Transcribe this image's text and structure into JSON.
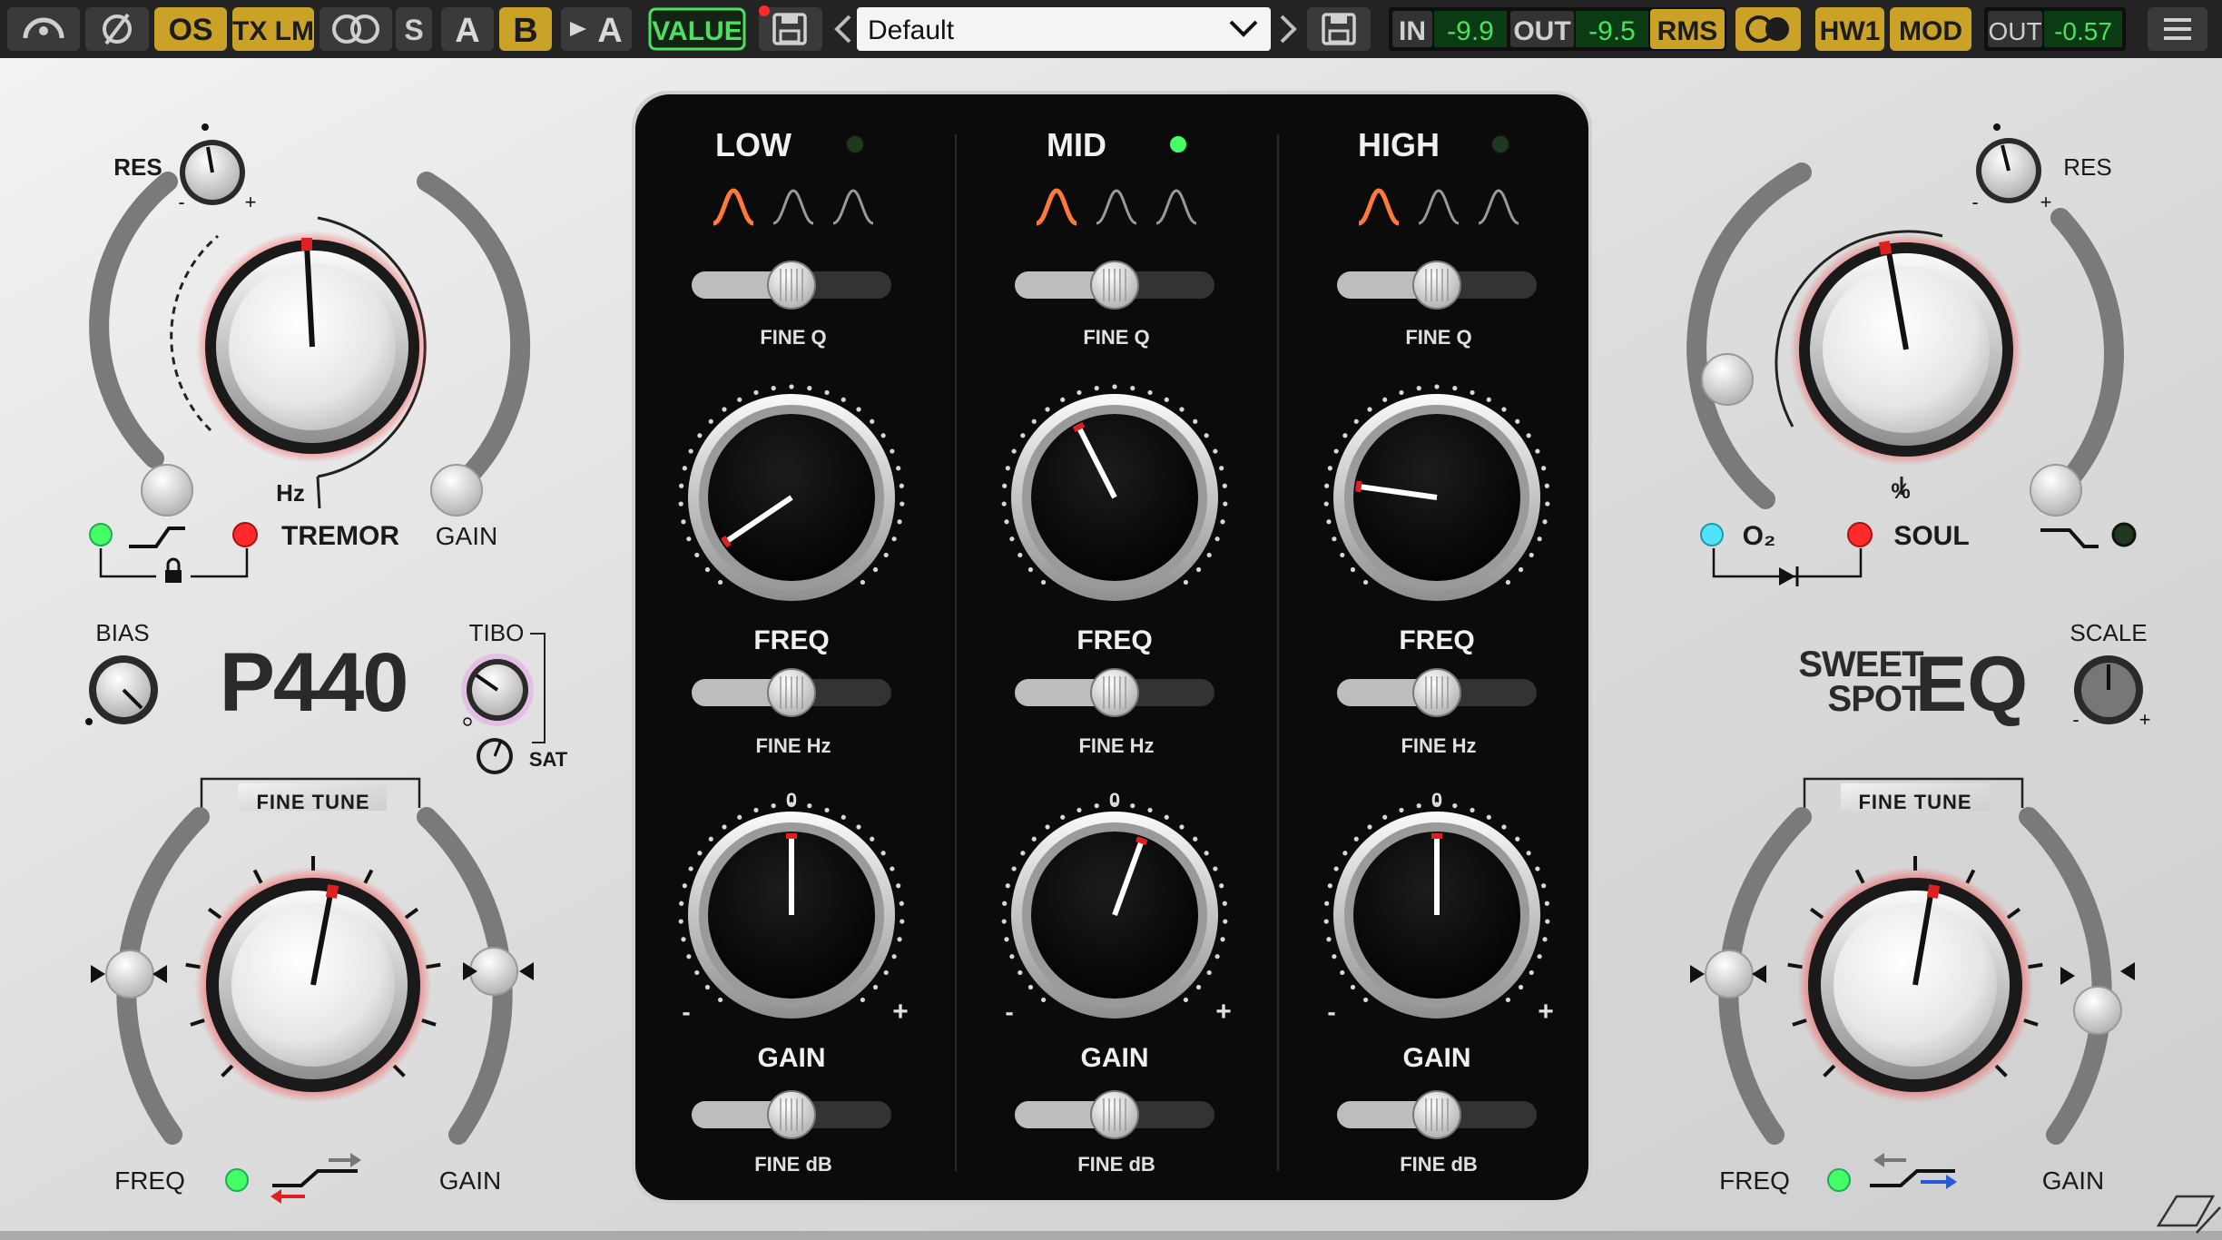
{
  "toolbar": {
    "os": "OS",
    "tx_lm": "TX LM",
    "s": "S",
    "a": "A",
    "b": "B",
    "copy_to_a": "A",
    "value": "VALUE",
    "preset": "Default",
    "in_label": "IN",
    "in_value": "-9.9",
    "out_label": "OUT",
    "out_value": "-9.5",
    "rms": "RMS",
    "hw1": "HW1",
    "mod": "MOD",
    "out2_label": "OUT",
    "out2_value": "-0.57"
  },
  "left": {
    "res": "RES",
    "tremor": "TREMOR",
    "gain_top": "GAIN",
    "hz": "Hz",
    "bias": "BIAS",
    "model": "P440",
    "tibo": "TIBO",
    "sat": "SAT",
    "fine_tune": "FINE TUNE",
    "freq": "FREQ",
    "gain_bottom": "GAIN",
    "minus": "-",
    "plus": "+"
  },
  "right": {
    "res": "RES",
    "o2": "O₂",
    "soul": "SOUL",
    "percent": "%",
    "logo_line1": "SWEET",
    "logo_line2": "SPOT",
    "logo_eq": "EQ",
    "scale": "SCALE",
    "fine_tune": "FINE TUNE",
    "freq": "FREQ",
    "gain_bottom": "GAIN",
    "minus": "-",
    "plus": "+"
  },
  "bands": [
    {
      "name": "LOW",
      "fine_q": "FINE Q",
      "freq": "FREQ",
      "fine_hz": "FINE Hz",
      "zero": "0",
      "minus": "-",
      "plus": "+",
      "gain": "GAIN",
      "fine_db": "FINE dB"
    },
    {
      "name": "MID",
      "fine_q": "FINE Q",
      "freq": "FREQ",
      "fine_hz": "FINE Hz",
      "zero": "0",
      "minus": "-",
      "plus": "+",
      "gain": "GAIN",
      "fine_db": "FINE dB"
    },
    {
      "name": "HIGH",
      "fine_q": "FINE Q",
      "freq": "FREQ",
      "fine_hz": "FINE Hz",
      "zero": "0",
      "minus": "-",
      "plus": "+",
      "gain": "GAIN",
      "fine_db": "FINE dB"
    }
  ],
  "colors": {
    "toolbar_bg": "#232323",
    "button": "#3b3b3b",
    "button_active": "#c9a227",
    "meter_green": "#4de060",
    "led_green": "#44ff66",
    "led_red": "#ff2a2a",
    "led_cyan": "#4fe3ff",
    "panel": "#0b0b0b",
    "face": "#dedede",
    "pointer_red": "#e02020"
  }
}
